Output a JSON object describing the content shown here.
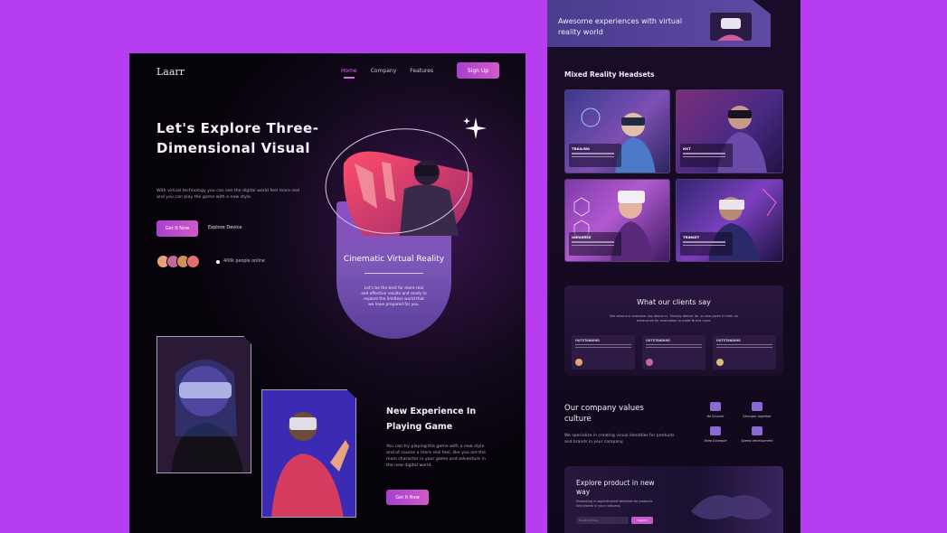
{
  "left_page": {
    "logo": "Laarr",
    "nav": [
      "Home",
      "Company",
      "Features"
    ],
    "signup_label": "Sign Up",
    "hero": {
      "title": "Let's Explore Three-Dimensional Visual",
      "description": "With virtual technology you can see the digital world feel more real and you can play the game with a new style.",
      "get_label": "Get It Now",
      "explore_label": "Explore Device",
      "online_text": "400k people online"
    },
    "card": {
      "title": "Cinematic Virtual Reality",
      "text": "Let's be the best for more real and effective results and ready to explore the limitless world that we have prepared for you."
    },
    "section": {
      "title": "New Experience In Playing Game",
      "description": "You can try playing the game with a new style and of course a more real feel, like you are the main character in your game and adventure in the new digital world.",
      "get_label": "Get It Now"
    }
  },
  "right_page": {
    "banner_text": "Awesome experiences with virtual reality world",
    "mr_title": "Mixed Reality Headsets",
    "tiles": [
      {
        "label": "TRAILING"
      },
      {
        "label": "NXT"
      },
      {
        "label": "UNIVERSE"
      },
      {
        "label": "TRINKET"
      }
    ],
    "clients": {
      "title": "What our clients say",
      "subtitle": "See what our customer say about us. Sharply deliver for us new given in their an exhaustive for evaluation to make Brand Laarr.",
      "reviews": [
        {
          "label": "OUTSTANDING"
        },
        {
          "label": "OUTSTANDING"
        },
        {
          "label": "OUTSTANDING"
        }
      ]
    },
    "values": {
      "title": "Our company values culture",
      "description": "We specialize in creating visual identities for products and brands in your company.",
      "items": [
        "Be Sincere",
        "Stronger together",
        "Keep Example",
        "Speed development"
      ]
    },
    "explore": {
      "title": "Explore product in new way",
      "description": "Presenting in sophisticated identities for products and brands in your company.",
      "input_placeholder": "Email Address",
      "button_label": "Submit"
    }
  },
  "colors": {
    "background": "#b63df0",
    "accent": "#c65acc",
    "card": "#7c57b7"
  }
}
